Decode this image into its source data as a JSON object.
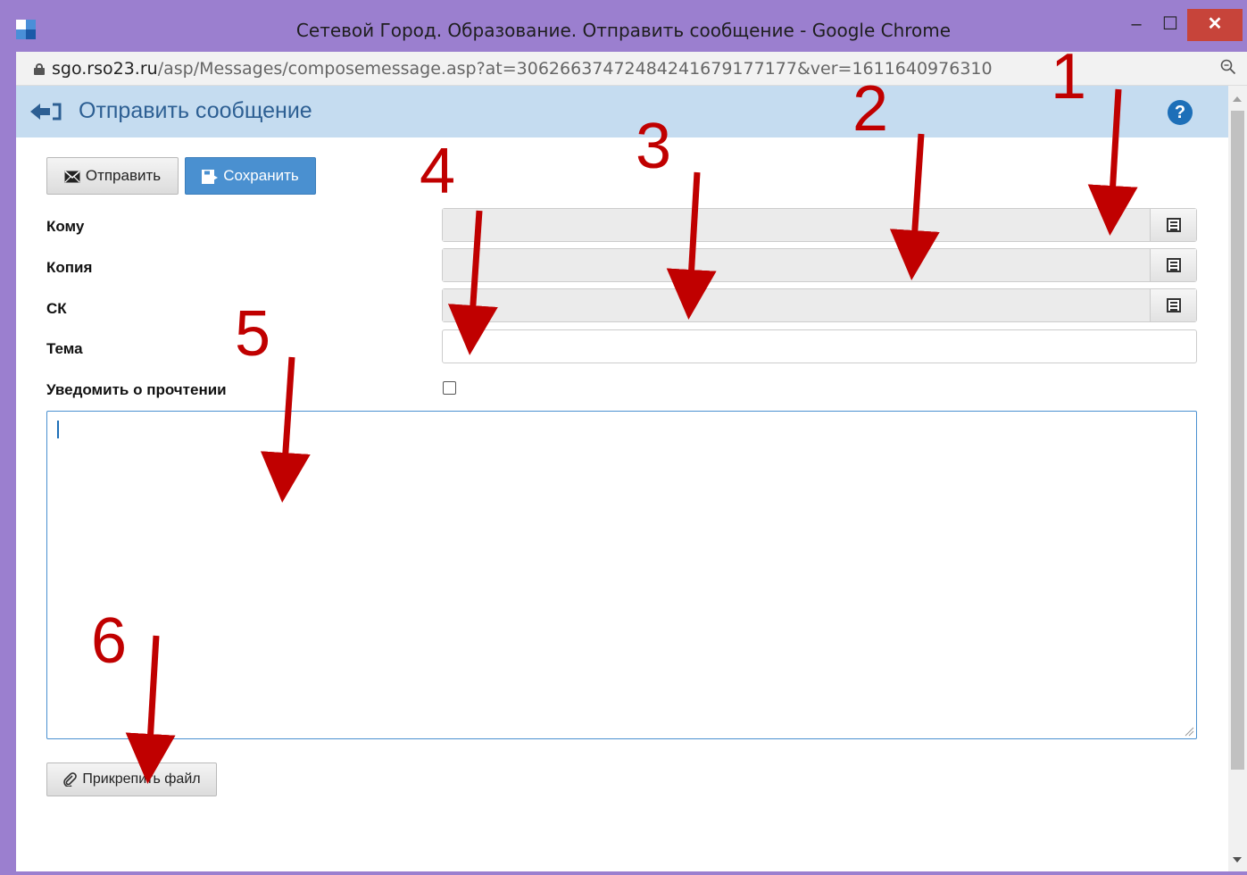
{
  "window": {
    "title": "Сетевой Город. Образование. Отправить сообщение - Google Chrome",
    "minimize_glyph": "–",
    "maximize_glyph": "☐",
    "close_glyph": "✕"
  },
  "address_bar": {
    "url_host": "sgo.rso23.ru",
    "url_path": "/asp/Messages/composemessage.asp?at=306266374724842416791771​77&ver=1611640976310",
    "lock_icon": "lock-icon",
    "zoom_icon": "zoom-icon"
  },
  "header": {
    "title": "Отправить сообщение",
    "back_icon": "back-arrow-icon",
    "help_glyph": "?"
  },
  "toolbar": {
    "send_label": "Отправить",
    "save_label": "Сохранить",
    "send_icon": "envelope-icon",
    "save_icon": "save-icon"
  },
  "form": {
    "to_label": "Кому",
    "cc_label": "Копия",
    "bcc_label": "СК",
    "subject_label": "Тема",
    "read_receipt_label": "Уведомить о прочтении",
    "read_receipt_checked": false,
    "subject_value": "",
    "body_value": ""
  },
  "attach": {
    "label": "Прикрепить файл",
    "icon": "paperclip-icon"
  },
  "annotations": [
    "1",
    "2",
    "3",
    "4",
    "5",
    "6"
  ],
  "colors": {
    "annotation": "#c00000",
    "header_bg": "#c5dcf0",
    "primary_button": "#4a90d0",
    "title_bar": "#9b7fcf"
  }
}
